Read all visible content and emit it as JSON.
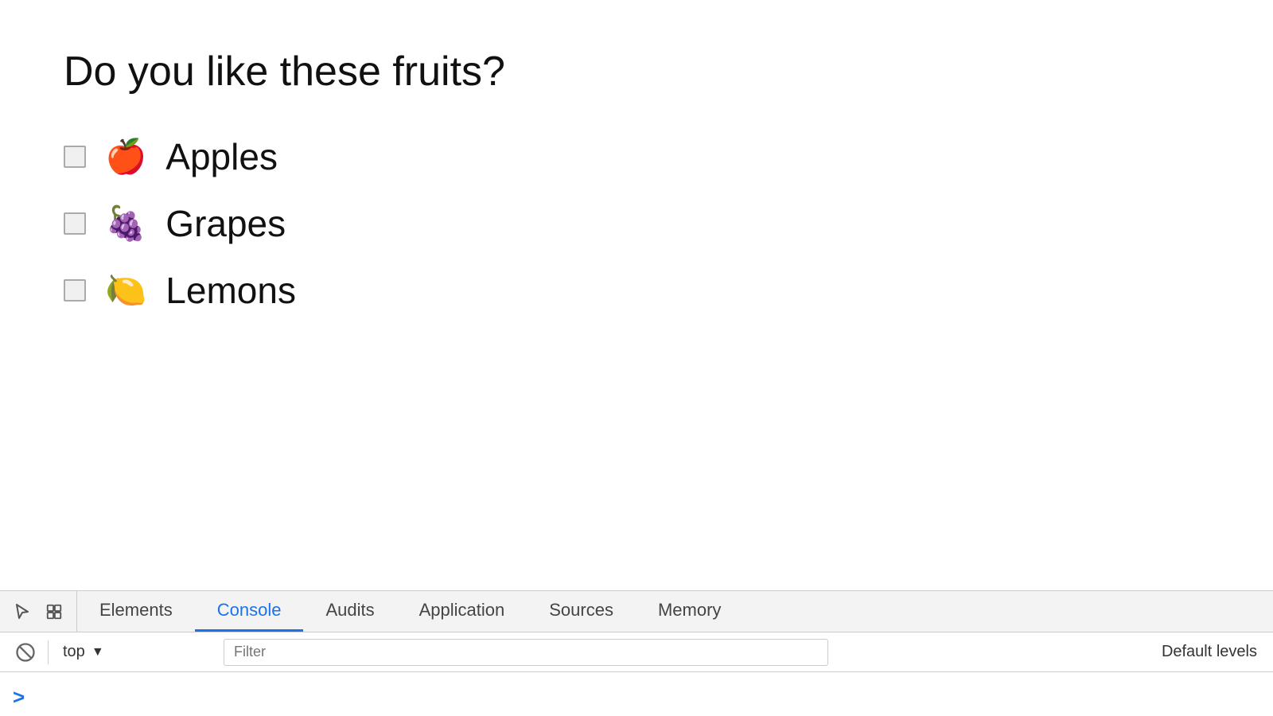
{
  "page": {
    "title": "Do you like these fruits?",
    "fruits": [
      {
        "id": "apples",
        "emoji": "🍎",
        "name": "Apples"
      },
      {
        "id": "grapes",
        "emoji": "🍇",
        "name": "Grapes"
      },
      {
        "id": "lemons",
        "emoji": "🍋",
        "name": "Lemons"
      }
    ]
  },
  "devtools": {
    "tabs": [
      {
        "id": "elements",
        "label": "Elements",
        "active": false
      },
      {
        "id": "console",
        "label": "Console",
        "active": true
      },
      {
        "id": "audits",
        "label": "Audits",
        "active": false
      },
      {
        "id": "application",
        "label": "Application",
        "active": false
      },
      {
        "id": "sources",
        "label": "Sources",
        "active": false
      },
      {
        "id": "memory",
        "label": "Memory",
        "active": false
      }
    ],
    "console_bar": {
      "context": "top",
      "filter_placeholder": "Filter",
      "default_levels": "Default levels"
    },
    "console_prompt_symbol": ">"
  }
}
